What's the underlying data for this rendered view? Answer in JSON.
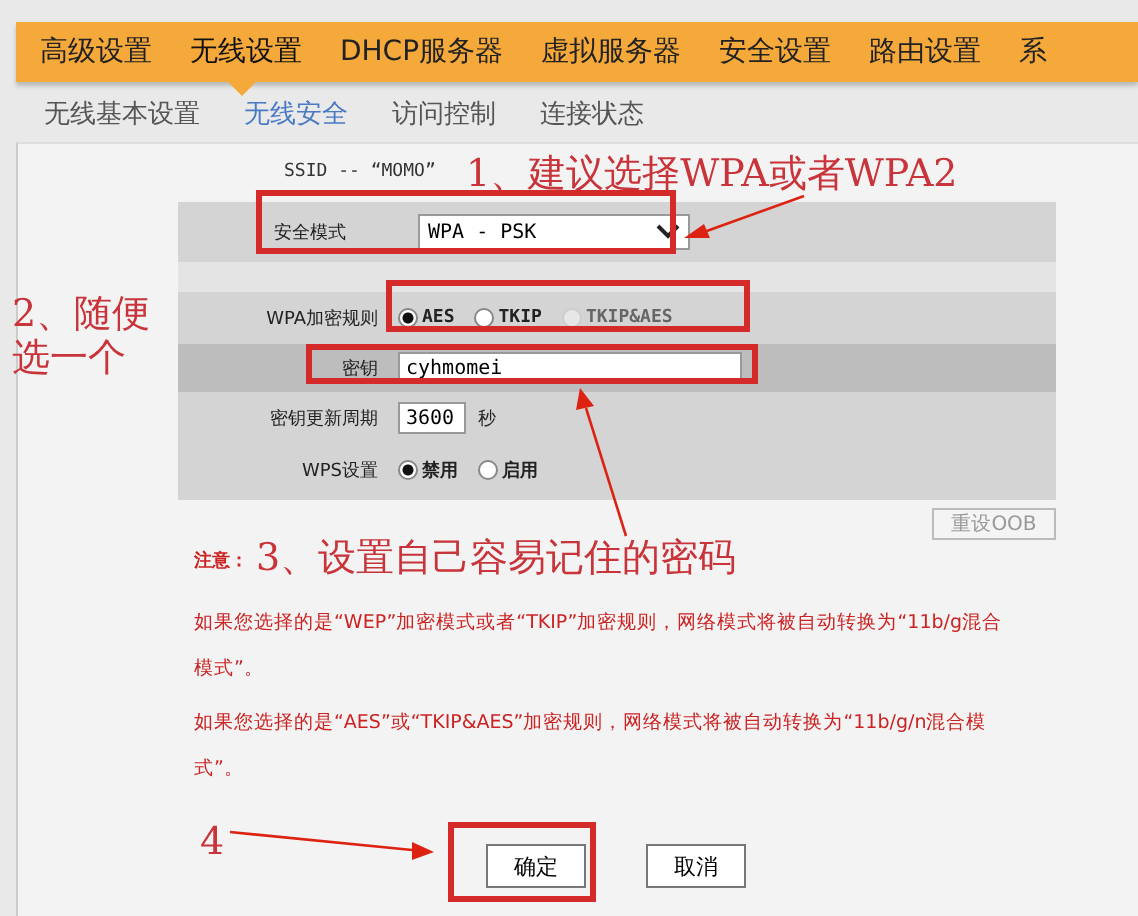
{
  "nav": [
    {
      "label": "高级设置",
      "selected": false
    },
    {
      "label": "无线设置",
      "selected": true
    },
    {
      "label": "DHCP服务器",
      "selected": false
    },
    {
      "label": "虚拟服务器",
      "selected": false
    },
    {
      "label": "安全设置",
      "selected": false
    },
    {
      "label": "路由设置",
      "selected": false
    },
    {
      "label": "系",
      "selected": false
    }
  ],
  "subtabs": [
    {
      "label": "无线基本设置",
      "selected": false
    },
    {
      "label": "无线安全",
      "selected": true
    },
    {
      "label": "访问控制",
      "selected": false
    },
    {
      "label": "连接状态",
      "selected": false
    }
  ],
  "ssid": "SSID -- “MOMO”",
  "form": {
    "mode": {
      "label": "安全模式",
      "value": "WPA - PSK"
    },
    "cipher": {
      "label": "WPA加密规则",
      "options": [
        {
          "label": "AES",
          "selected": true,
          "disabled": false
        },
        {
          "label": "TKIP",
          "selected": false,
          "disabled": false
        },
        {
          "label": "TKIP&AES",
          "selected": false,
          "disabled": true
        }
      ]
    },
    "key": {
      "label": "密钥",
      "value": "cyhmomei"
    },
    "renew": {
      "label": "密钥更新周期",
      "value": "3600",
      "unit": "秒"
    },
    "wps": {
      "label": "WPS设置",
      "options": [
        {
          "label": "禁用",
          "selected": true
        },
        {
          "label": "启用",
          "selected": false
        }
      ]
    }
  },
  "reset_button": "重设OOB",
  "notice_label": "注意：",
  "notes": [
    "如果您选择的是“WEP”加密模式或者“TKIP”加密规则，网络模式将被自动转换为“11b/g混合模式”。",
    "如果您选择的是“AES”或“TKIP&AES”加密规则，网络模式将被自动转换为“11b/g/n混合模式”。"
  ],
  "buttons": [
    "确定",
    "取消"
  ],
  "annotations": [
    {
      "lines": [
        "1、建议选择WPA或者WPA2"
      ]
    },
    {
      "lines": [
        "2、随便",
        "选一个"
      ]
    },
    {
      "lines": [
        "3、设置自己容易记住的密码"
      ]
    },
    {
      "lines": [
        "4"
      ]
    }
  ]
}
